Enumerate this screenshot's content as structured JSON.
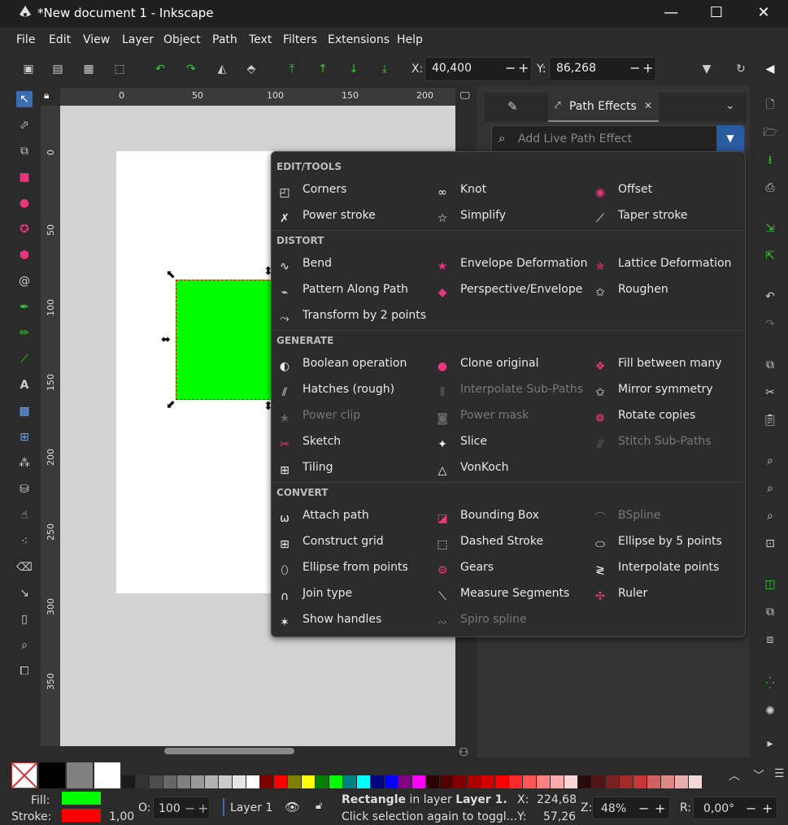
{
  "window": {
    "title": "*New document 1 - Inkscape",
    "minimize": "—",
    "maximize": "☐",
    "close": "✕"
  },
  "menu": [
    "File",
    "Edit",
    "View",
    "Layer",
    "Object",
    "Path",
    "Text",
    "Filters",
    "Extensions",
    "Help"
  ],
  "toolbar": {
    "x_label": "X:",
    "x_value": "40,400",
    "y_label": "Y:",
    "y_value": "86,268",
    "minus": "−",
    "plus": "+"
  },
  "ruler": {
    "h": [
      "0",
      "50",
      "100",
      "150",
      "200"
    ],
    "v": [
      "0",
      "50",
      "100",
      "150",
      "200",
      "250",
      "300",
      "350"
    ]
  },
  "dock": {
    "tab_label": "Path Effects",
    "tab_close": "✕",
    "search_placeholder": "Add Live Path Effect"
  },
  "popup": {
    "sections": [
      "EDIT/TOOLS",
      "DISTORT",
      "GENERATE",
      "CONVERT"
    ],
    "edit_tools": [
      {
        "label": "Corners",
        "icon": "corners-icon",
        "enabled": true
      },
      {
        "label": "Knot",
        "icon": "knot-icon",
        "enabled": true
      },
      {
        "label": "Offset",
        "icon": "offset-icon",
        "enabled": true
      },
      {
        "label": "Power stroke",
        "icon": "power-stroke-icon",
        "enabled": true
      },
      {
        "label": "Simplify",
        "icon": "simplify-icon",
        "enabled": true
      },
      {
        "label": "Taper stroke",
        "icon": "taper-stroke-icon",
        "enabled": true
      }
    ],
    "distort": [
      {
        "label": "Bend",
        "icon": "bend-icon",
        "enabled": true
      },
      {
        "label": "Envelope Deformation",
        "icon": "envelope-icon",
        "enabled": true
      },
      {
        "label": "Lattice Deformation",
        "icon": "lattice-icon",
        "enabled": true
      },
      {
        "label": "Pattern Along Path",
        "icon": "pattern-along-path-icon",
        "enabled": true
      },
      {
        "label": "Perspective/Envelope",
        "icon": "perspective-icon",
        "enabled": true
      },
      {
        "label": "Roughen",
        "icon": "roughen-icon",
        "enabled": true
      },
      {
        "label": "Transform by 2 points",
        "icon": "transform-2pts-icon",
        "enabled": true
      }
    ],
    "generate": [
      {
        "label": "Boolean operation",
        "icon": "boolean-icon",
        "enabled": true
      },
      {
        "label": "Clone original",
        "icon": "clone-original-icon",
        "enabled": true
      },
      {
        "label": "Fill between many",
        "icon": "fill-between-icon",
        "enabled": true
      },
      {
        "label": "Hatches (rough)",
        "icon": "hatches-icon",
        "enabled": true
      },
      {
        "label": "Interpolate Sub-Paths",
        "icon": "interpolate-subpaths-icon",
        "enabled": false
      },
      {
        "label": "Mirror symmetry",
        "icon": "mirror-icon",
        "enabled": true
      },
      {
        "label": "Power clip",
        "icon": "power-clip-icon",
        "enabled": false
      },
      {
        "label": "Power mask",
        "icon": "power-mask-icon",
        "enabled": false
      },
      {
        "label": "Rotate copies",
        "icon": "rotate-copies-icon",
        "enabled": true
      },
      {
        "label": "Sketch",
        "icon": "sketch-icon",
        "enabled": true
      },
      {
        "label": "Slice",
        "icon": "slice-icon",
        "enabled": true
      },
      {
        "label": "Stitch Sub-Paths",
        "icon": "stitch-icon",
        "enabled": false
      },
      {
        "label": "Tiling",
        "icon": "tiling-icon",
        "enabled": true
      },
      {
        "label": "VonKoch",
        "icon": "vonkoch-icon",
        "enabled": true
      }
    ],
    "convert": [
      {
        "label": "Attach path",
        "icon": "attach-path-icon",
        "enabled": true
      },
      {
        "label": "Bounding Box",
        "icon": "bounding-box-icon",
        "enabled": true
      },
      {
        "label": "BSpline",
        "icon": "bspline-icon",
        "enabled": false
      },
      {
        "label": "Construct grid",
        "icon": "construct-grid-icon",
        "enabled": true
      },
      {
        "label": "Dashed Stroke",
        "icon": "dashed-stroke-icon",
        "enabled": true
      },
      {
        "label": "Ellipse by 5 points",
        "icon": "ellipse-5pts-icon",
        "enabled": true
      },
      {
        "label": "Ellipse from points",
        "icon": "ellipse-points-icon",
        "enabled": true
      },
      {
        "label": "Gears",
        "icon": "gears-icon",
        "enabled": true
      },
      {
        "label": "Interpolate points",
        "icon": "interpolate-points-icon",
        "enabled": true
      },
      {
        "label": "Join type",
        "icon": "join-type-icon",
        "enabled": true
      },
      {
        "label": "Measure Segments",
        "icon": "measure-icon",
        "enabled": true
      },
      {
        "label": "Ruler",
        "icon": "ruler-icon",
        "enabled": true
      },
      {
        "label": "Show handles",
        "icon": "show-handles-icon",
        "enabled": true
      },
      {
        "label": "Spiro spline",
        "icon": "spiro-icon",
        "enabled": false
      }
    ]
  },
  "status": {
    "fill_label": "Fill:",
    "stroke_label": "Stroke:",
    "stroke_width": "1,00",
    "fill_color": "#00ff00",
    "stroke_color": "#ff0000",
    "opacity_label": "O:",
    "opacity_value": "100",
    "layer": "Layer 1",
    "msg_type": "Rectangle",
    "msg_mid": " in layer ",
    "msg_layer": "Layer 1.",
    "msg_line2": "Click selection again to toggl...",
    "x_label": "X:",
    "x_value": "224,68",
    "y_label": "Y:",
    "y_value": "57,26",
    "zoom_label": "Z:",
    "zoom_value": "48%",
    "rot_label": "R:",
    "rot_value": "0,00°"
  },
  "accent": "#e8357d"
}
